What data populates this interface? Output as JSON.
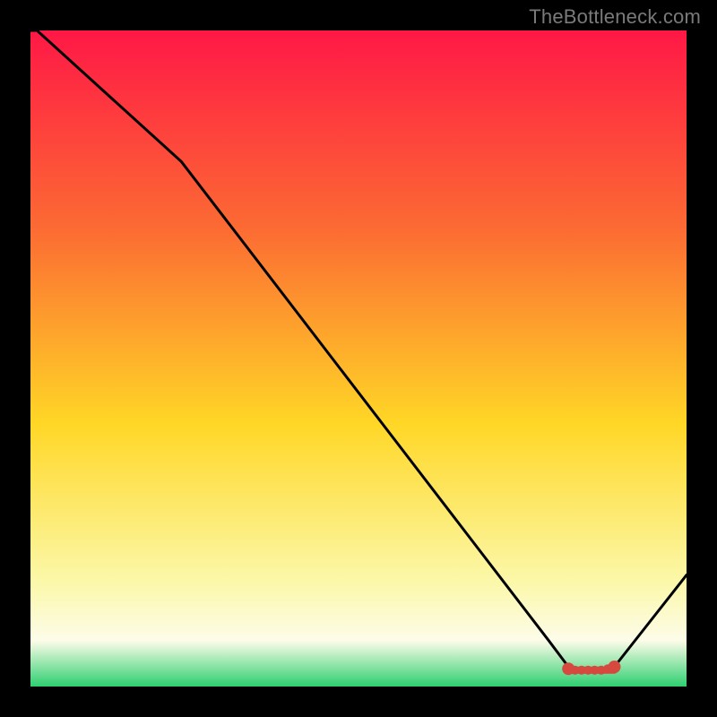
{
  "watermark": "TheBottleneck.com",
  "colors": {
    "bg": "#000000",
    "line": "#000000",
    "gradient_top": "#ff1846",
    "gradient_upper": "#fc6a33",
    "gradient_mid": "#ffd726",
    "gradient_lower": "#fbf8a9",
    "gradient_white": "#fdfce9",
    "gradient_green": "#2ecf6f",
    "chip": "#d6493e"
  },
  "chart_data": {
    "type": "line",
    "title": "",
    "xlabel": "",
    "ylabel": "",
    "xlim": [
      0,
      100
    ],
    "ylim": [
      0,
      100
    ],
    "x": [
      0,
      1,
      23,
      79,
      82,
      83,
      84,
      88,
      89,
      100
    ],
    "y": [
      100,
      100,
      80,
      7,
      3,
      2.5,
      2.5,
      2.5,
      3,
      17
    ],
    "marker_points_x": [
      82,
      83,
      84,
      85,
      86,
      87,
      88,
      89
    ],
    "marker_points_y": [
      2.7,
      2.5,
      2.5,
      2.5,
      2.5,
      2.5,
      2.7,
      3.0
    ]
  }
}
